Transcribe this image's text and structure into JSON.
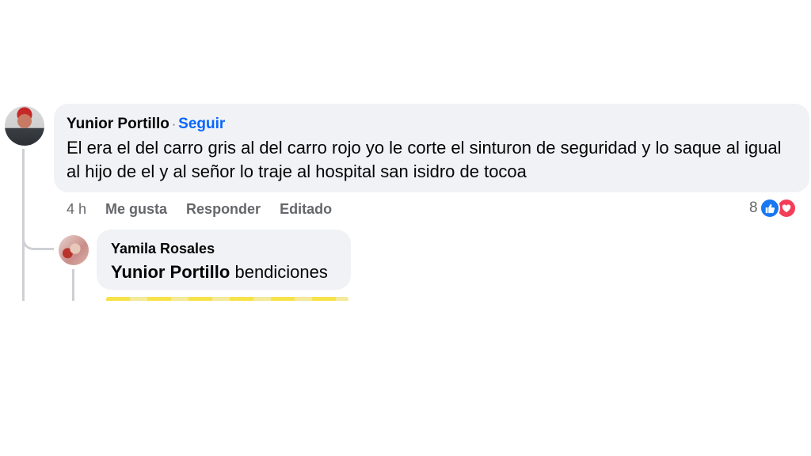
{
  "comment": {
    "author": "Yunior Portillo",
    "separator": "·",
    "follow_label": "Seguir",
    "text": "El era el del carro gris al del carro rojo yo le corte el sinturon de seguridad y lo saque al igual al hijo de el y al señor lo traje al hospital san isidro de tocoa",
    "actions": {
      "time": "4 h",
      "like_label": "Me gusta",
      "reply_label": "Responder",
      "edited_label": "Editado"
    },
    "reactions": {
      "count": "8",
      "types": [
        "like-icon",
        "love-icon"
      ]
    }
  },
  "reply": {
    "author": "Yamila Rosales",
    "mention": "Yunior Portillo",
    "text": "bendiciones"
  },
  "colors": {
    "bubble_bg": "#f0f2f5",
    "link_blue": "#0866ff",
    "muted_text": "#65676b",
    "like_blue": "#1877f2",
    "love_red": "#f33e58",
    "thread_line": "#ced0d4"
  }
}
